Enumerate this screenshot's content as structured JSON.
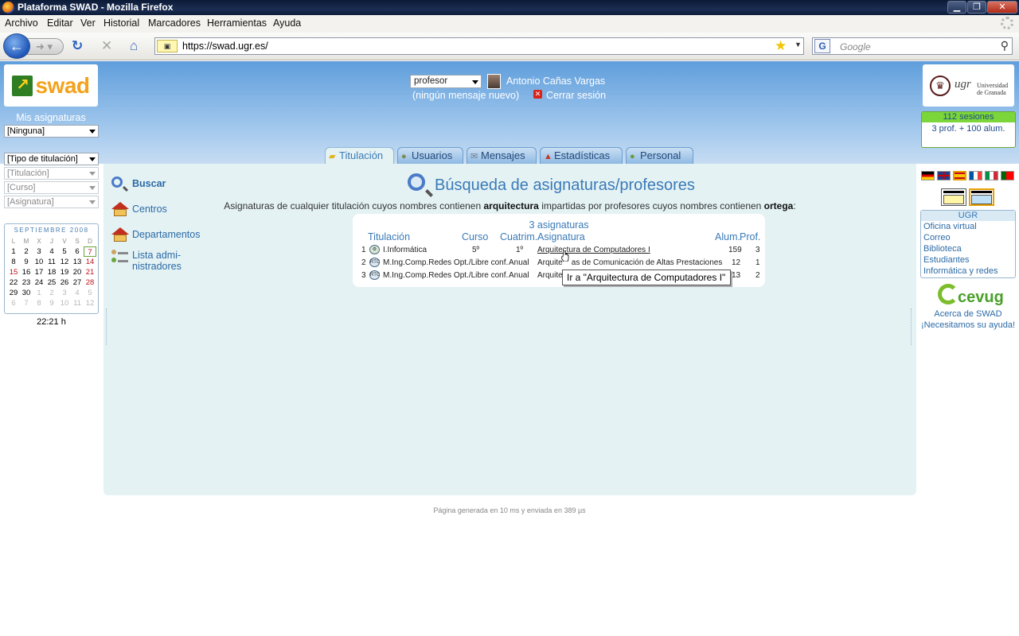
{
  "browser": {
    "window_title": "Plataforma SWAD - Mozilla Firefox",
    "menu": [
      "Archivo",
      "Editar",
      "Ver",
      "Historial",
      "Marcadores",
      "Herramientas",
      "Ayuda"
    ],
    "url": "https://swad.ugr.es/",
    "site_icon": "swad-favicon",
    "search_placeholder": "Google",
    "search_engine_label": "G"
  },
  "header": {
    "logo_text": "swad",
    "mis_asignaturas": "Mis asignaturas",
    "course_select": "[Ninguna]",
    "role_select": "profesor",
    "user_name": "Antonio Cañas Vargas",
    "messages": "(ningún mensaje nuevo)",
    "logout": "Cerrar sesión",
    "university_logo_main": "ugr",
    "university_logo_sub1": "Universidad",
    "university_logo_sub2": "de Granada",
    "sessions": "112 sesiones",
    "sessions_detail": "3 prof. + 100 alum."
  },
  "tabs": [
    {
      "label": "Titulación",
      "icon": "folder-icon",
      "active": true
    },
    {
      "label": "Usuarios",
      "icon": "users-icon",
      "active": false
    },
    {
      "label": "Mensajes",
      "icon": "envelope-icon",
      "active": false
    },
    {
      "label": "Estadísticas",
      "icon": "chart-icon",
      "active": false
    },
    {
      "label": "Personal",
      "icon": "person-icon",
      "active": false
    }
  ],
  "filters": {
    "degree_type": "[Tipo de titulación]",
    "degree": "[Titulación]",
    "year": "[Curso]",
    "subject": "[Asignatura]"
  },
  "calendar": {
    "month": "SEPTIEMBRE 2008",
    "weekdays": [
      "L",
      "M",
      "X",
      "J",
      "V",
      "S",
      "D"
    ],
    "weeks": [
      [
        "1",
        "2",
        "3",
        "4",
        "5",
        "6",
        "7"
      ],
      [
        "8",
        "9",
        "10",
        "11",
        "12",
        "13",
        "14"
      ],
      [
        "15",
        "16",
        "17",
        "18",
        "19",
        "20",
        "21"
      ],
      [
        "22",
        "23",
        "24",
        "25",
        "26",
        "27",
        "28"
      ],
      [
        "29",
        "30",
        "1",
        "2",
        "3",
        "4",
        "5"
      ],
      [
        "6",
        "7",
        "8",
        "9",
        "10",
        "11",
        "12"
      ]
    ],
    "time": "22:21 h"
  },
  "sidebar": {
    "items": [
      {
        "label": "Buscar",
        "bold": true
      },
      {
        "label": "Centros"
      },
      {
        "label": "Departamentos"
      },
      {
        "label": "Lista admi-",
        "label2": "nistradores"
      }
    ]
  },
  "main": {
    "title": "Búsqueda de asignaturas/profesores",
    "desc_pre": "Asignaturas de cualquier titulación cuyos nombres contienen ",
    "desc_term1": "arquitectura",
    "desc_mid": " impartidas por profesores cuyos nombres contienen ",
    "desc_term2": "ortega",
    "desc_post": ":",
    "result_count": "3 asignaturas",
    "columns": [
      "Titulación",
      "Curso",
      "Cuatrim.",
      "Asignatura",
      "Alum.",
      "Prof."
    ],
    "rows": [
      {
        "n": "1",
        "degree": "I.Informática",
        "year": "5º",
        "term": "1º",
        "subject": "Arquitectura de Computadores I",
        "students": "159",
        "profs": "3"
      },
      {
        "n": "2",
        "degree": "M.Ing.Comp.Redes Opt./Libre conf.",
        "year": "",
        "term": "Anual",
        "subject": "Arquite    as de Comunicación de Altas Prestaciones",
        "students": "12",
        "profs": "1"
      },
      {
        "n": "3",
        "degree": "M.Ing.Comp.Redes Opt./Libre conf.",
        "year": "",
        "term": "Anual",
        "subject": "Arquitec",
        "students": "13",
        "profs": "2"
      }
    ],
    "tooltip": "Ir a \"Arquitectura de Computadores I\""
  },
  "right": {
    "flags": [
      "german-flag-icon",
      "english-flag-icon",
      "spanish-flag-icon",
      "french-flag-icon",
      "italian-flag-icon",
      "portuguese-flag-icon"
    ],
    "ugr_header": "UGR",
    "ugr_links": [
      "Oficina virtual",
      "Correo",
      "Biblioteca",
      "Estudiantes",
      "Informática y redes"
    ],
    "cevug_logo": "cevug",
    "about": "Acerca de SWAD",
    "help": "¡Necesitamos su ayuda!"
  },
  "footer": "Página generada en 10 ms y enviada en 389 µs",
  "colors": {
    "header_blue": "#5f9edc",
    "content_bg": "#e4f2f4",
    "link_blue": "#2c6aa6",
    "title_blue": "#3a7ab8",
    "accent_orange": "#f4a21c",
    "sessions_green": "#7bd63a"
  }
}
